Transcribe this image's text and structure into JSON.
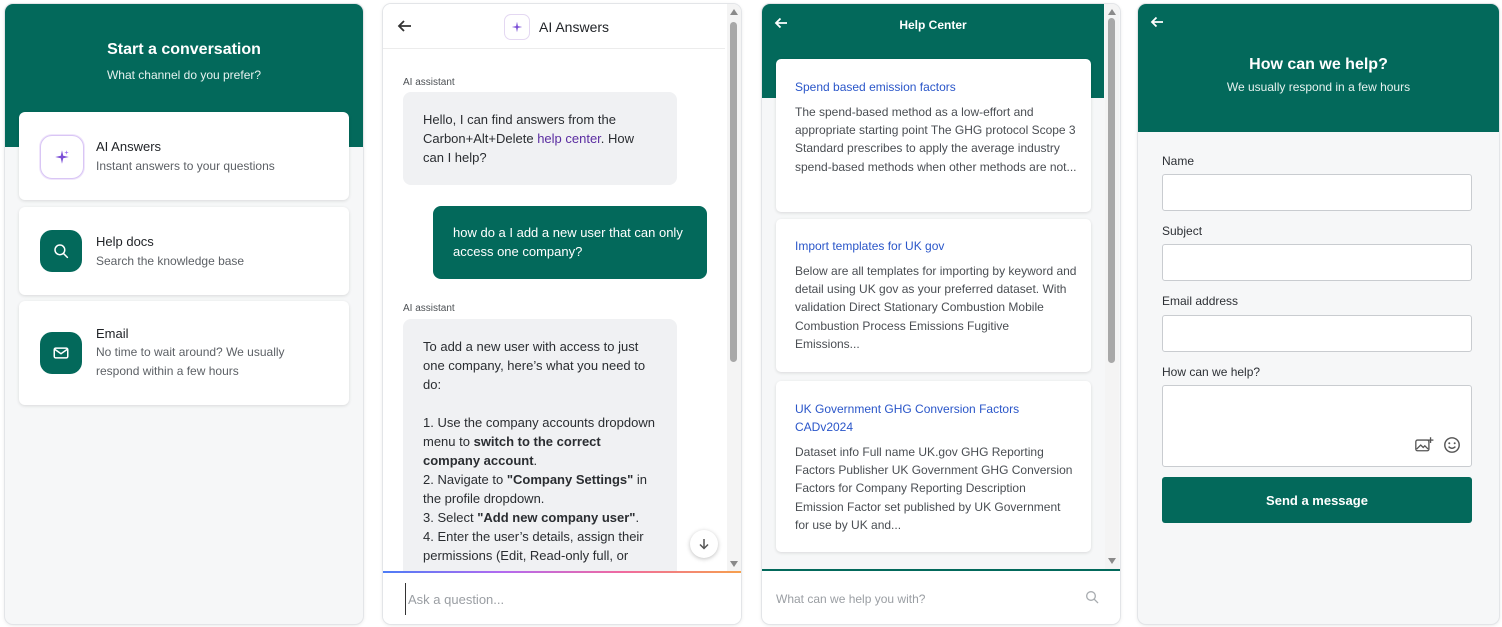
{
  "conversation": {
    "title": "Start a conversation",
    "subtitle": "What channel do you prefer?",
    "options": [
      {
        "icon": "sparkle-icon",
        "title": "AI Answers",
        "description": "Instant answers to your questions"
      },
      {
        "icon": "search-icon",
        "title": "Help docs",
        "description": "Search the knowledge base"
      },
      {
        "icon": "envelope-icon",
        "title": "Email",
        "description": "No time to wait around? We usually respond within a few hours"
      }
    ]
  },
  "ai_chat": {
    "title": "AI Answers",
    "assistant_label": "AI assistant",
    "messages": {
      "greeting_before": "Hello, I can find answers from the Carbon+Alt+Delete ",
      "greeting_link": "help center",
      "greeting_after": ". How can I help?",
      "user": "how do a I add a new user that can only access one company?",
      "answer_intro": "To add a new user with access to just one company, here’s what you need to do:",
      "step1_a": "1. Use the company accounts dropdown menu to ",
      "step1_b": "switch to the correct company account",
      "step1_c": ".",
      "step2_a": "2. Navigate to ",
      "step2_b": "\"Company Settings\"",
      "step2_c": " in the profile dropdown.",
      "step3_a": "3. Select ",
      "step3_b": "\"Add new company user\"",
      "step3_c": ".",
      "step4": "4. Enter the user’s details, assign their permissions (Edit, Read-only full, or"
    },
    "input_placeholder": "Ask a question..."
  },
  "help_center": {
    "title": "Help Center",
    "articles": [
      {
        "title": "Spend based emission factors",
        "excerpt": "The spend-based method as a low-effort and appropriate starting point The GHG protocol Scope 3 Standard prescribes to apply the average industry spend-based methods when other methods are not..."
      },
      {
        "title": "Import templates for UK gov",
        "excerpt": "Below are all templates for importing by keyword and detail using UK gov as your preferred dataset. With validation Direct Stationary Combustion Mobile Combustion Process Emissions Fugitive Emissions..."
      },
      {
        "title": "UK Government GHG Conversion Factors CADv2024",
        "excerpt": "Dataset info Full name UK.gov GHG Reporting Factors Publisher UK Government GHG Conversion Factors for Company Reporting Description Emission Factor set published by UK Government for use by UK and..."
      }
    ],
    "search_placeholder": "What can we help you with?"
  },
  "contact": {
    "title": "How can we help?",
    "subtitle": "We usually respond in a few hours",
    "fields": {
      "name": "Name",
      "subject": "Subject",
      "email": "Email address",
      "message": "How can we help?"
    },
    "name_value": "",
    "subject_value": "",
    "email_value": "",
    "message_value": "",
    "send_label": "Send a message"
  },
  "colors": {
    "brand_green": "#03695b",
    "link_purple": "#5b2da1",
    "article_blue": "#2a56c9"
  }
}
